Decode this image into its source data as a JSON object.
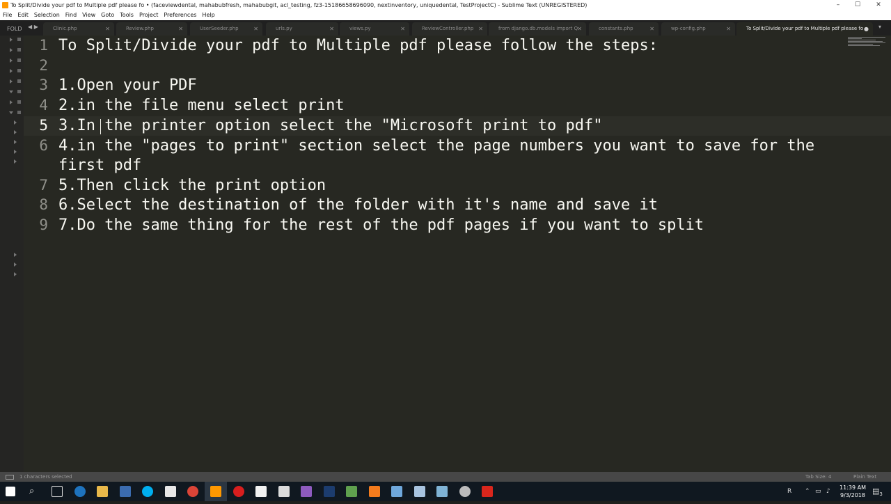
{
  "window": {
    "title": "To Split/Divide your pdf to Multiple pdf please fo • (faceviewdental, mahabubfresh, mahabubgit, acl_testing, fz3-15186658696090, nextinventory, uniquedental, TestProjectC) - Sublime Text (UNREGISTERED)",
    "minimize": "–",
    "maximize": "☐",
    "close": "✕"
  },
  "menu": [
    "File",
    "Edit",
    "Selection",
    "Find",
    "View",
    "Goto",
    "Tools",
    "Project",
    "Preferences",
    "Help"
  ],
  "sidebar": {
    "label": "FOLD"
  },
  "tabs": [
    {
      "label": "Clinic.php",
      "close": "✕"
    },
    {
      "label": "Review.php",
      "close": "✕"
    },
    {
      "label": "UserSeeder.php",
      "close": "✕"
    },
    {
      "label": "urls.py",
      "close": "✕"
    },
    {
      "label": "views.py",
      "close": "✕"
    },
    {
      "label": "ReviewController.php",
      "close": "✕"
    },
    {
      "label": "from django.db.models import Q",
      "close": "✕"
    },
    {
      "label": "constants.php",
      "close": "✕"
    },
    {
      "label": "wp-config.php",
      "close": "✕"
    },
    {
      "label": "To Split/Divide your pdf to Multiple pdf please fo",
      "close": "●"
    }
  ],
  "editor": {
    "lines": [
      {
        "num": "1",
        "text": "To Split/Divide your pdf to Multiple pdf please follow the steps:"
      },
      {
        "num": "2",
        "text": ""
      },
      {
        "num": "3",
        "text": "1.Open your PDF"
      },
      {
        "num": "4",
        "text": "2.in the file menu select print"
      },
      {
        "num": "5",
        "text": "3.In the printer option select the \"Microsoft print to pdf\""
      },
      {
        "num": "6",
        "text": "4.in the \"pages to print\" section select the page numbers you want to save for the"
      },
      {
        "num": "",
        "text": "first pdf"
      },
      {
        "num": "7",
        "text": "5.Then click the print option"
      },
      {
        "num": "8",
        "text": "6.Select the destination of the folder with it's name and save it"
      },
      {
        "num": "9",
        "text": "7.Do the same thing for the rest of the pdf pages if you want to split"
      }
    ],
    "current_line": "5"
  },
  "status": {
    "selection": "1 characters selected",
    "tab_size": "Tab Size: 4",
    "syntax": "Plain Text"
  },
  "taskbar": {
    "time": "11:39 AM",
    "date": "9/3/2018",
    "notification_count": "3"
  },
  "colors": {
    "editor_bg": "#272822",
    "text": "#f8f8f2",
    "gutter": "#90908a"
  }
}
